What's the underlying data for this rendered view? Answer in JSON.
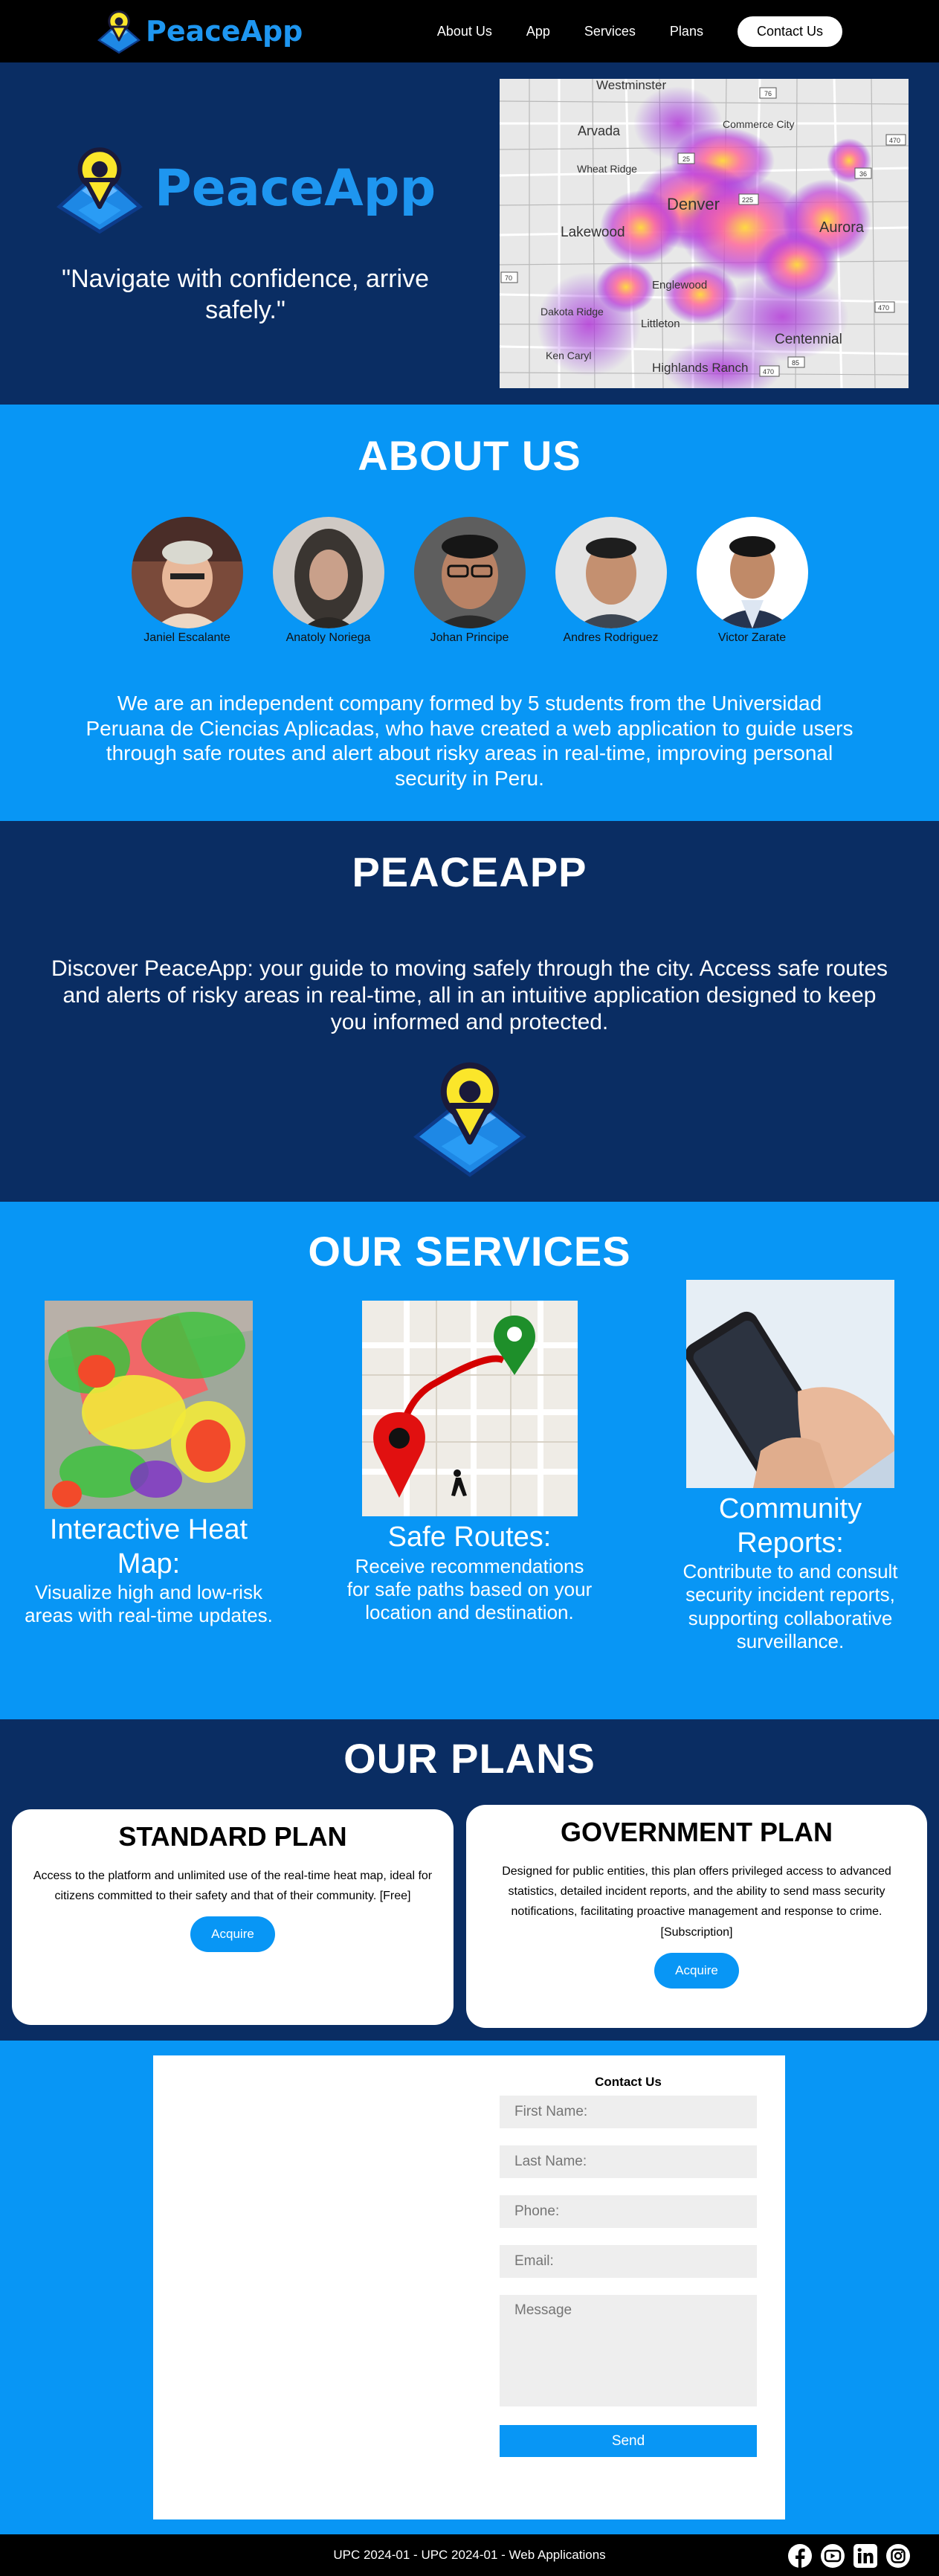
{
  "nav": {
    "brand": "PeaceApp",
    "links": [
      "About Us",
      "App",
      "Services",
      "Plans"
    ],
    "contact": "Contact Us"
  },
  "hero": {
    "brand": "PeaceApp",
    "quote": "\"Navigate with confidence, arrive safely.\"",
    "map_labels": [
      "Westminster",
      "Arvada",
      "Commerce City",
      "Wheat Ridge",
      "Denver",
      "Lakewood",
      "Aurora",
      "Englewood",
      "Dakota Ridge",
      "Littleton",
      "Centennial",
      "Ken Caryl",
      "Highlands Ranch",
      "25",
      "70",
      "76",
      "36",
      "470",
      "225",
      "85",
      "470",
      "470"
    ]
  },
  "about": {
    "title": "ABOUT US",
    "members": [
      "Janiel Escalante",
      "Anatoly Noriega",
      "Johan Principe",
      "Andres Rodriguez",
      "Victor Zarate"
    ],
    "text": "We are an independent company formed by 5 students from the Universidad Peruana de Ciencias Aplicadas, who have created a web application to guide users through safe routes and alert about risky areas in real-time, improving personal security in Peru."
  },
  "peace": {
    "title": "PEACEAPP",
    "text": "Discover PeaceApp: your guide to moving safely through the city. Access safe routes and alerts of risky areas in real-time, all in an intuitive application designed to keep you informed and protected."
  },
  "services": {
    "title": "OUR SERVICES",
    "items": [
      {
        "title": "Interactive Heat Map:",
        "desc": "Visualize high and low-risk areas with real-time updates."
      },
      {
        "title": "Safe Routes:",
        "desc": "Receive recommendations for safe paths based on your location and destination."
      },
      {
        "title": "Community Reports:",
        "desc": "Contribute to and consult security incident reports, supporting collaborative surveillance."
      }
    ]
  },
  "plans": {
    "title": "OUR PLANS",
    "items": [
      {
        "title": "STANDARD PLAN",
        "desc": "Access to the platform and unlimited use of the real-time heat map, ideal for citizens committed to their safety and that of their community. [Free]",
        "button": "Acquire"
      },
      {
        "title": "GOVERNMENT PLAN",
        "desc": "Designed for public entities, this plan offers privileged access to advanced statistics, detailed incident reports, and the ability to send mass security notifications, facilitating proactive management and response to crime. [Subscription]",
        "button": "Acquire"
      }
    ]
  },
  "contact": {
    "title": "Contact Us",
    "placeholders": {
      "first_name": "First Name:",
      "last_name": "Last Name:",
      "phone": "Phone:",
      "email": "Email:",
      "message": "Message"
    },
    "send": "Send"
  },
  "footer": {
    "text": "UPC 2024-01 - UPC 2024-01 - Web Applications",
    "social": [
      "facebook-icon",
      "youtube-icon",
      "linkedin-icon",
      "instagram-icon"
    ]
  }
}
